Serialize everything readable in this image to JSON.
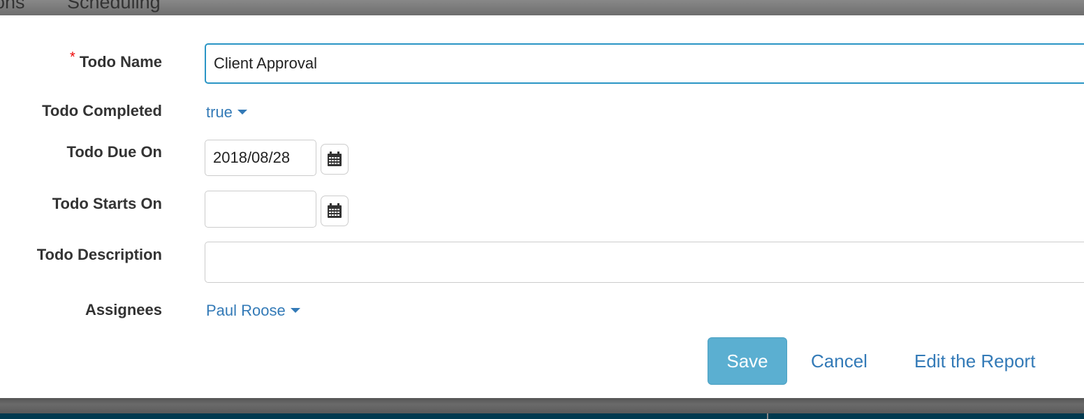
{
  "nav": {
    "tabs": [
      {
        "label": "ons"
      },
      {
        "label": "Scheduling"
      }
    ]
  },
  "form": {
    "required_mark": "*",
    "todo_name": {
      "label": "Todo Name",
      "value": "Client Approval"
    },
    "todo_completed": {
      "label": "Todo Completed",
      "value": "true"
    },
    "todo_due_on": {
      "label": "Todo Due On",
      "value": "2018/08/28",
      "icon": "calendar-icon"
    },
    "todo_starts_on": {
      "label": "Todo Starts On",
      "value": "",
      "icon": "calendar-icon"
    },
    "todo_description": {
      "label": "Todo Description",
      "value": ""
    },
    "assignees": {
      "label": "Assignees",
      "value": "Paul Roose"
    }
  },
  "actions": {
    "save": "Save",
    "cancel": "Cancel",
    "edit_report": "Edit the Report"
  },
  "colors": {
    "accent": "#337ab7",
    "save_button": "#5bafd1",
    "focus_border": "#2a95c5",
    "required": "#ee0000"
  }
}
